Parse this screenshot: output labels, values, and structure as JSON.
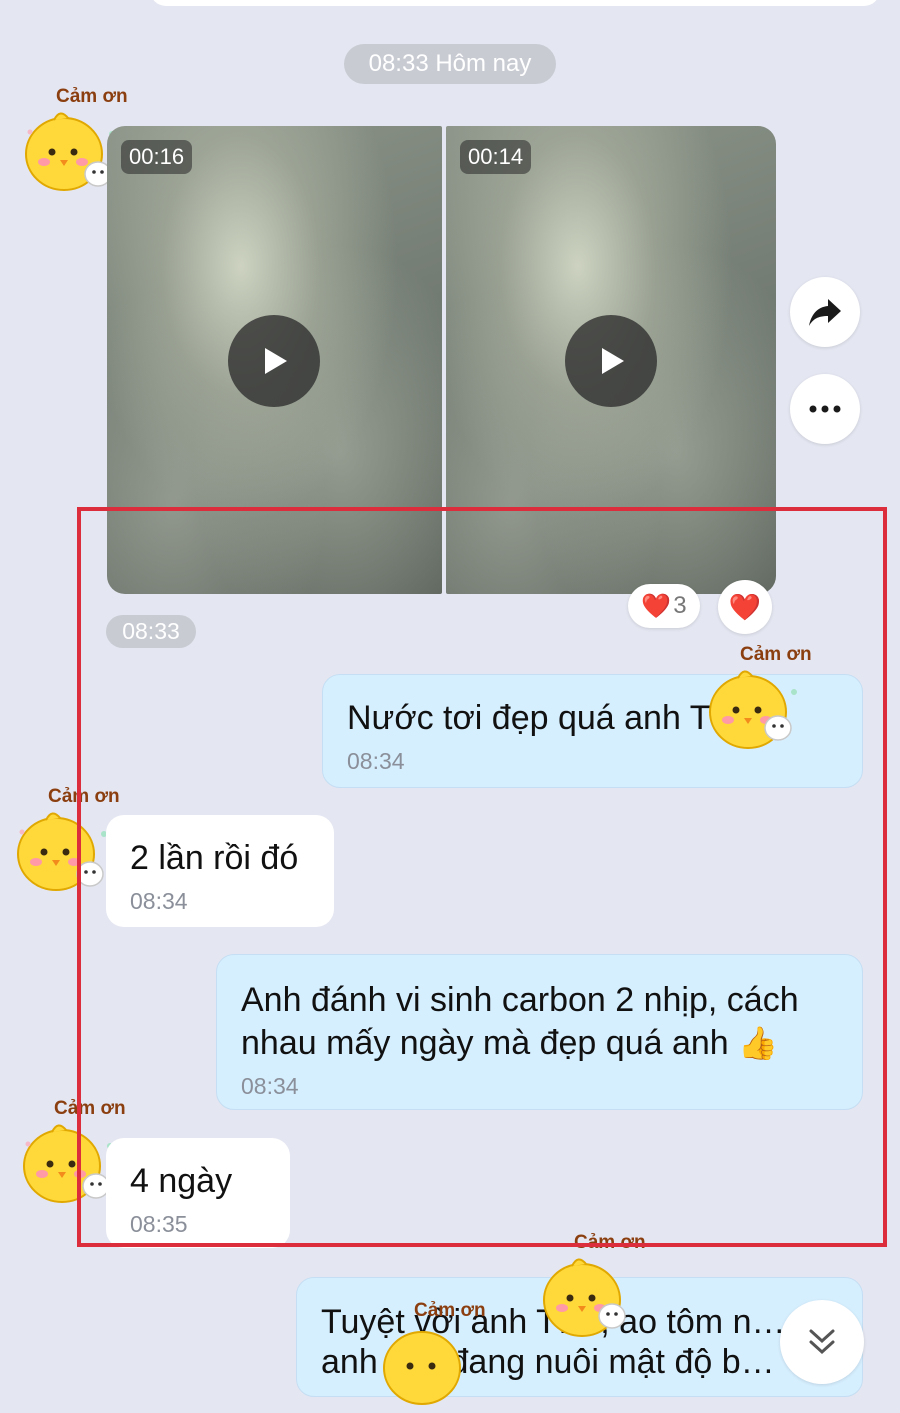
{
  "header": {
    "date_pill": "08:33 Hôm nay"
  },
  "sticker": {
    "caption": "Cảm ơn"
  },
  "videos": [
    {
      "duration": "00:16"
    },
    {
      "duration": "00:14"
    }
  ],
  "reactions": {
    "heart_count": "3",
    "heart_icon": "❤️"
  },
  "group_time": "08:33",
  "messages": [
    {
      "direction": "out",
      "text": "Nước tơi đẹp quá anh T",
      "emoji": "👍",
      "time": "08:34"
    },
    {
      "direction": "in",
      "text": "2 lần rồi đó",
      "time": "08:34"
    },
    {
      "direction": "out",
      "text": "Anh đánh vi sinh carbon 2 nhịp, cách nhau mấy ngày mà đẹp quá anh",
      "emoji": "👍",
      "time": "08:34"
    },
    {
      "direction": "in",
      "text": "4 ngày",
      "time": "08:35"
    },
    {
      "direction": "out",
      "text": "Tuyệt vời anh T… , ao tôm n… anh … f đang nuôi mật độ b…",
      "time": ""
    }
  ],
  "colors": {
    "background": "#e4e6f1",
    "outgoing_bubble": "#d6efff",
    "incoming_bubble": "#ffffff",
    "highlight_frame": "#dc2d3d"
  }
}
